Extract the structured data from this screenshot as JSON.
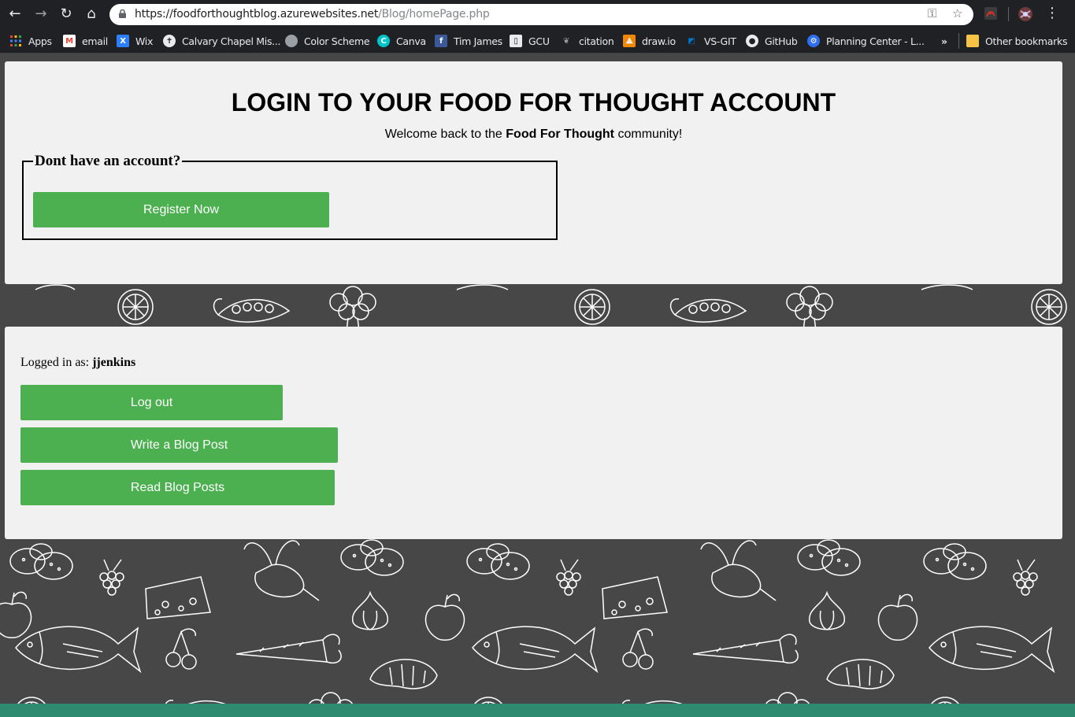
{
  "browser": {
    "url_host": "https://foodforthoughtblog.azurewebsites.net",
    "url_path": "/Blog/homePage.php",
    "bookmarks": [
      {
        "label": "Apps",
        "icon": "apps-grid-icon"
      },
      {
        "label": "email",
        "icon": "gmail-icon"
      },
      {
        "label": "Wix",
        "icon": "wix-icon"
      },
      {
        "label": "Calvary Chapel Mis...",
        "icon": "calvary-icon"
      },
      {
        "label": "Color Scheme",
        "icon": "color-scheme-icon"
      },
      {
        "label": "Canva",
        "icon": "canva-icon"
      },
      {
        "label": "Tim James",
        "icon": "facebook-icon"
      },
      {
        "label": "GCU",
        "icon": "gcu-icon"
      },
      {
        "label": "citation",
        "icon": "citation-icon"
      },
      {
        "label": "draw.io",
        "icon": "drawio-icon"
      },
      {
        "label": "VS-GIT",
        "icon": "azure-devops-icon"
      },
      {
        "label": "GitHub",
        "icon": "github-icon"
      },
      {
        "label": "Planning Center - L...",
        "icon": "planning-center-icon"
      }
    ],
    "overflow_label": "»",
    "other_bookmarks": "Other bookmarks"
  },
  "login_panel": {
    "title": "LOGIN TO YOUR FOOD FOR THOUGHT ACCOUNT",
    "welcome_prefix": "Welcome back to the ",
    "welcome_brand": "Food For Thought",
    "welcome_suffix": " community!",
    "fieldset_legend": "Dont have an account?",
    "register_button": "Register Now"
  },
  "user_panel": {
    "logged_prefix": "Logged in as: ",
    "username": "jjenkins",
    "logout_button": "Log out",
    "write_button": "Write a Blog Post",
    "read_button": "Read Blog Posts"
  },
  "colors": {
    "accent_green": "#4caf50",
    "panel_bg": "#f1f1f1",
    "page_bg": "#474747",
    "chrome_bg": "#202124"
  }
}
